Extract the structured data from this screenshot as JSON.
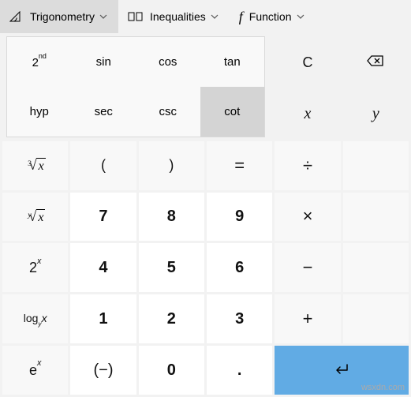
{
  "toolbar": {
    "trigonometry": "Trigonometry",
    "inequalities": "Inequalities",
    "function": "Function"
  },
  "trig_panel": {
    "second": "2",
    "second_sup": "nd",
    "sin": "sin",
    "cos": "cos",
    "tan": "tan",
    "hyp": "hyp",
    "sec": "sec",
    "csc": "csc",
    "cot": "cot"
  },
  "buttons": {
    "clear": "C",
    "var_x": "x",
    "var_y": "y",
    "cuberoot_deg": "3",
    "cuberoot_rad": "x",
    "nroot_deg": "y",
    "nroot_rad": "x",
    "pow2_base": "2",
    "pow2_exp": "x",
    "log_label": "log",
    "log_sub": "y",
    "log_arg": "x",
    "e_base": "e",
    "e_exp": "x",
    "lparen": "(",
    "rparen": ")",
    "equals": "=",
    "divide": "÷",
    "multiply": "×",
    "minus": "−",
    "plus": "+",
    "n7": "7",
    "n8": "8",
    "n9": "9",
    "n4": "4",
    "n5": "5",
    "n6": "6",
    "n1": "1",
    "n2": "2",
    "n3": "3",
    "n0": "0",
    "negate": "(−)",
    "dot": ".",
    "enter": "↵"
  },
  "watermark": "wsxdn.com"
}
